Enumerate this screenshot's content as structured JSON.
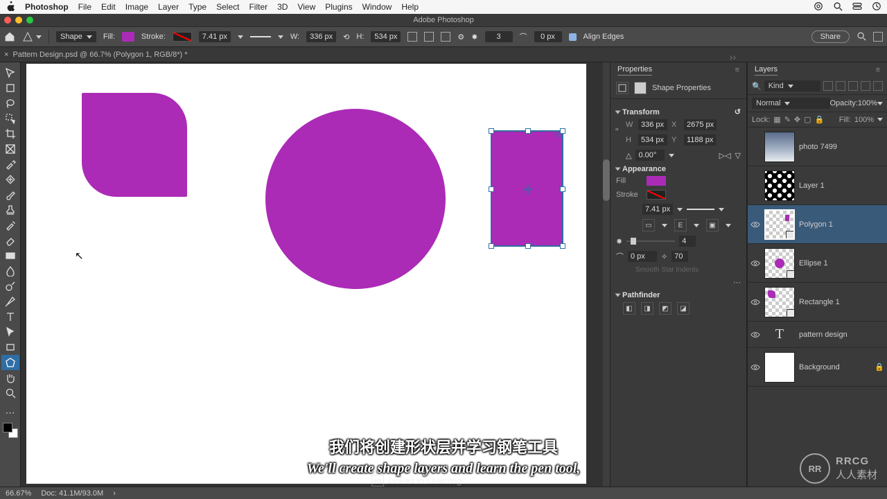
{
  "colors": {
    "accent": "#2f6ea5",
    "shape_fill": "#ab2bb6"
  },
  "mac_menu": {
    "app": "Photoshop",
    "items": [
      "File",
      "Edit",
      "Image",
      "Layer",
      "Type",
      "Select",
      "Filter",
      "3D",
      "View",
      "Plugins",
      "Window",
      "Help"
    ]
  },
  "window": {
    "title": "Adobe Photoshop"
  },
  "options_bar": {
    "mode_label": "Shape",
    "fill_label": "Fill:",
    "stroke_label": "Stroke:",
    "stroke_width": "7.41 px",
    "W_label": "W:",
    "W_value": "336 px",
    "H_label": "H:",
    "H_value": "534 px",
    "sides_value": "3",
    "radius_value": "0 px",
    "align_edges_label": "Align Edges",
    "share_label": "Share"
  },
  "doc_tab": {
    "close": "×",
    "label": "Pattern Design.psd @ 66.7% (Polygon 1, RGB/8*) *"
  },
  "tools": [
    "move",
    "artboard",
    "lasso",
    "quick-select",
    "crop",
    "frame",
    "eyedropper",
    "heal",
    "brush",
    "stamp",
    "history-brush",
    "eraser",
    "gradient",
    "blur",
    "dodge",
    "pen",
    "type",
    "path-select",
    "rectangle",
    "polygon",
    "hand",
    "zoom"
  ],
  "selected_tool_index": 19,
  "properties": {
    "title": "Properties",
    "header": "Shape Properties",
    "transform": {
      "label": "Transform",
      "W": "336 px",
      "X": "2675 px",
      "H": "534 px",
      "Y": "1188 px",
      "angle": "0.00°"
    },
    "appearance": {
      "label": "Appearance",
      "fill_label": "Fill",
      "stroke_label": "Stroke",
      "stroke_width": "7.41 px",
      "sides_value": "4",
      "radius_value": "0 px",
      "star_ratio": "70",
      "smooth_label": "Smooth Star Indents"
    },
    "pathfinder": {
      "label": "Pathfinder"
    }
  },
  "layers_panel": {
    "title": "Layers",
    "kind_label": "Kind",
    "blend_mode": "Normal",
    "opacity_label": "Opacity:",
    "opacity_value": "100%",
    "lock_label": "Lock:",
    "fill_label": "Fill:",
    "fill_value": "100%",
    "items": [
      {
        "name": "photo 7499",
        "visible": false,
        "type": "image"
      },
      {
        "name": "Layer 1",
        "visible": false,
        "type": "pattern"
      },
      {
        "name": "Polygon 1",
        "visible": true,
        "type": "shape",
        "active": true
      },
      {
        "name": "Ellipse 1",
        "visible": true,
        "type": "shape"
      },
      {
        "name": "Rectangle 1",
        "visible": true,
        "type": "shape"
      },
      {
        "name": "pattern design",
        "visible": true,
        "type": "text"
      },
      {
        "name": "Background",
        "visible": true,
        "type": "bg",
        "locked": true
      }
    ]
  },
  "status_bar": {
    "zoom": "66.67%",
    "doc": "Doc: 41.1M/93.0M"
  },
  "subtitles": {
    "cn": "我们将创建形状层并学习钢笔工具",
    "en": "We'll create shape layers and learn the pen tool,"
  },
  "watermark": {
    "left": "Linked in Learning",
    "right_logo": "RR",
    "right_line1": "RRCG",
    "right_line2": "人人素材"
  }
}
